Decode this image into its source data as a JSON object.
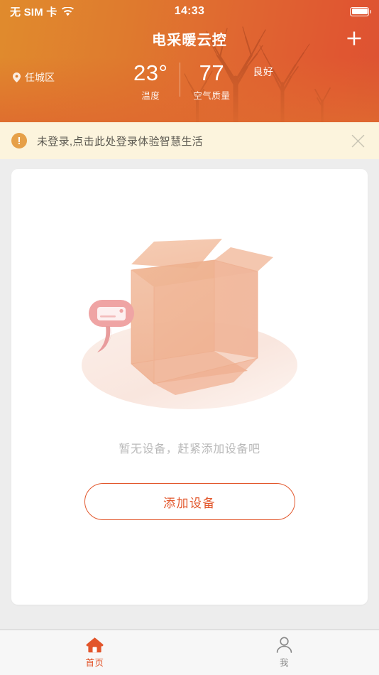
{
  "statusbar": {
    "carrier": "无 SIM 卡",
    "time": "14:33",
    "wifi_icon": "wifi-icon",
    "battery_icon": "battery-full-icon"
  },
  "header": {
    "title": "电采暖云控",
    "add_icon": "plus-icon",
    "location_icon": "location-pin-icon",
    "location": "任城区",
    "weather": {
      "temperature": "23°",
      "temperature_label": "温度",
      "air_quality": "77",
      "air_quality_label": "空气质量",
      "air_quality_desc": "良好"
    },
    "gradient_start": "#e08b2d",
    "gradient_end": "#dd5232"
  },
  "banner": {
    "warn_icon": "exclamation-circle-icon",
    "message": "未登录,点击此处登录体验智慧生活",
    "close_icon": "close-icon",
    "background": "#fcf4dd"
  },
  "main": {
    "illustration": "empty-box-illustration",
    "empty_text": "暂无设备，赶紧添加设备吧",
    "add_device_label": "添加设备",
    "accent": "#e2572c"
  },
  "tabbar": {
    "items": [
      {
        "icon": "home-icon",
        "label": "首页",
        "active": true
      },
      {
        "icon": "person-icon",
        "label": "我",
        "active": false
      }
    ],
    "active_color": "#e2552b",
    "inactive_color": "#8a8a8a"
  }
}
